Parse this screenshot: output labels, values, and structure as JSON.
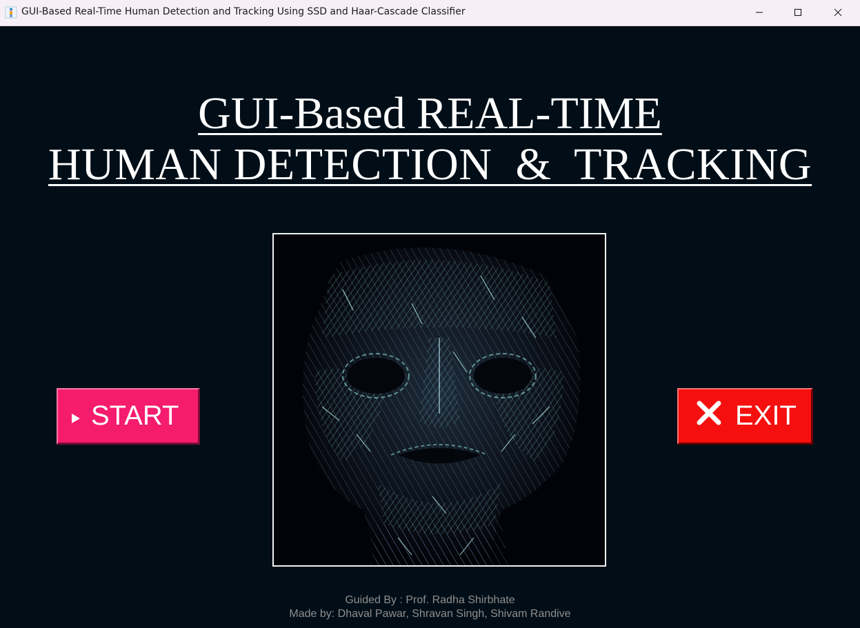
{
  "window": {
    "title": "GUI-Based Real-Time Human Detection and Tracking Using SSD and Haar-Cascade Classifier",
    "icon": "person-figure-icon",
    "controls": [
      "minimize-icon",
      "maximize-icon",
      "close-icon"
    ]
  },
  "heading": {
    "line1": "GUI-Based REAL-TIME",
    "line2": "HUMAN DETECTION  &  TRACKING"
  },
  "preview": {
    "icon": "wireframe-face-icon"
  },
  "buttons": {
    "start": {
      "label": "START",
      "icon": "play-triangle-icon",
      "color": "#f51c6e"
    },
    "exit": {
      "label": "EXIT",
      "icon": "close-x-icon",
      "color": "#f50f0f"
    }
  },
  "credits": {
    "guided": "Guided By : Prof. Radha Shirbhate",
    "made": "Made by: Dhaval Pawar, Shravan Singh, Shivam Randive"
  },
  "colors": {
    "background": "#010e17",
    "heading_text": "#ffffff",
    "credits_text": "#8f8f8f"
  }
}
